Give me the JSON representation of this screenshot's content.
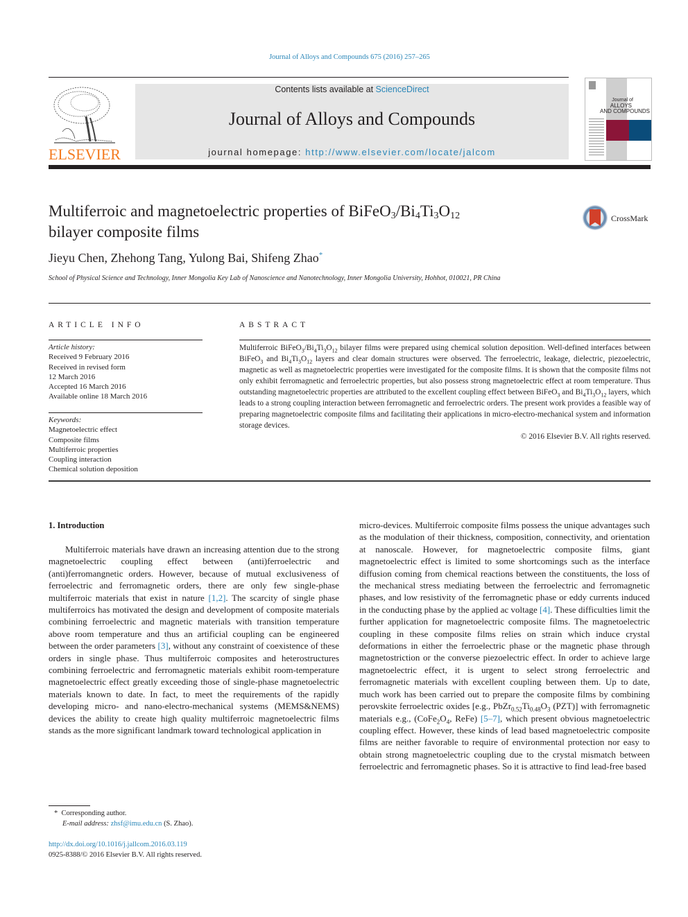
{
  "citation": "Journal of Alloys and Compounds 675 (2016) 257–265",
  "publisher": {
    "logo_text": "ELSEVIER",
    "logo_color": "#f47b20"
  },
  "header": {
    "contents_prefix": "Contents lists available at ",
    "contents_link": "ScienceDirect",
    "journal_title": "Journal of Alloys and Compounds",
    "homepage_prefix": "journal homepage: ",
    "homepage_url": "http://www.elsevier.com/locate/jalcom",
    "box_color": "#e6e6e6"
  },
  "cover": {
    "title_line1": "Journal of",
    "title_line2": "ALLOYS",
    "title_line3": "AND COMPOUNDS",
    "colors": {
      "crimson": "#8b1538",
      "blue": "#0a4c7a"
    }
  },
  "crossmark": {
    "label": "CrossMark"
  },
  "article": {
    "title_part1": "Multiferroic and magnetoelectric properties of BiFeO",
    "title_sub1": "3",
    "title_part2": "/Bi",
    "title_sub2": "4",
    "title_part3": "Ti",
    "title_sub3": "3",
    "title_part4": "O",
    "title_sub4": "12",
    "title_line2": "bilayer composite films",
    "authors": "Jieyu Chen, Zhehong Tang, Yulong Bai, Shifeng Zhao",
    "corresponding_mark": "*",
    "affiliation": "School of Physical Science and Technology, Inner Mongolia Key Lab of Nanoscience and Nanotechnology, Inner Mongolia University, Hohhot, 010021, PR China"
  },
  "article_info": {
    "heading": "ARTICLE INFO",
    "history_label": "Article history:",
    "history": [
      "Received 9 February 2016",
      "Received in revised form",
      "12 March 2016",
      "Accepted 16 March 2016",
      "Available online 18 March 2016"
    ],
    "keywords_label": "Keywords:",
    "keywords": [
      "Magnetoelectric effect",
      "Composite films",
      "Multiferroic properties",
      "Coupling interaction",
      "Chemical solution deposition"
    ]
  },
  "abstract": {
    "heading": "ABSTRACT",
    "s1a": "Multiferroic BiFeO",
    "s1b": "/Bi",
    "s1c": "Ti",
    "s1d": "O",
    "s1e": " bilayer films were prepared using chemical solution deposition. Well-defined interfaces between BiFeO",
    "s1f": " and Bi",
    "s1g": "Ti",
    "s1h": "O",
    "s1i": " layers and clear domain structures were observed. The ferroelectric, leakage, dielectric, piezoelectric, magnetic as well as magnetoelectric properties were investigated for the composite films. It is shown that the composite films not only exhibit ferromagnetic and ferroelectric properties, but also possess strong magnetoelectric effect at room temperature. Thus outstanding magnetoelectric properties are attributed to the excellent coupling effect between BiFeO",
    "s1j": " and Bi",
    "s1k": "Ti",
    "s1l": "O",
    "s1m": " layers, which leads to a strong coupling interaction between ferromagnetic and ferroelectric orders. The present work provides a feasible way of preparing magnetoelectric composite films and facilitating their applications in micro-electro-mechanical system and information storage devices.",
    "copyright": "© 2016 Elsevier B.V. All rights reserved."
  },
  "intro": {
    "heading": "1.  Introduction",
    "left": {
      "t1": "Multiferroic materials have drawn an increasing attention due to the strong magnetoelectric coupling effect between (anti)ferroelectric and (anti)ferromangnetic orders. However, because of mutual exclusiveness of ferroelectric and ferromagnetic orders, there are only few single-phase multiferroic materials that exist in nature ",
      "ref1": "[1,2]",
      "t2": ". The scarcity of single phase multiferroics has motivated the design and development of composite materials combining ferroelectric and magnetic materials with transition temperature above room temperature and thus an artificial coupling can be engineered between the order parameters ",
      "ref2": "[3]",
      "t3": ", without any constraint of coexistence of these orders in single phase. Thus multiferroic composites and heterostructures combining ferroelectric and ferromagnetic materials exhibit room-temperature magnetoelectric effect greatly exceeding those of single-phase magnetoelectric materials known to date. In fact, to meet the requirements of the rapidly developing micro- and nano-electro-mechanical systems (MEMS&NEMS) devices the ability to create high quality multiferroic magnetoelectric films stands as the more significant landmark toward technological application in"
    },
    "right": {
      "t1": "micro-devices. Multiferroic composite films possess the unique advantages such as the modulation of their thickness, composition, connectivity, and orientation at nanoscale. However, for magnetoelectric composite films, giant magnetoelectric effect is limited to some shortcomings such as the interface diffusion coming from chemical reactions between the constituents, the loss of the mechanical stress mediating between the ferroelectric and ferromagnetic phases, and low resistivity of the ferromagnetic phase or eddy currents induced in the conducting phase by the applied ac voltage ",
      "ref1": "[4]",
      "t2": ". These difficulties limit the further application for magnetoelectric composite films. The magnetoelectric coupling in these composite films relies on strain which induce crystal deformations in either the ferroelectric phase or the magnetic phase through magnetostriction or the converse piezoelectric effect. In order to achieve large magnetoelectric effect, it is urgent to select strong ferroelectric and ferromagnetic materials with excellent coupling between them. Up to date, much work has been carried out to prepare the composite films by combining perovskite ferroelectric oxides [e.g., PbZr",
      "sub1": "0.52",
      "t3": "Ti",
      "sub2": "0.48",
      "t4": "O",
      "sub3": "3",
      "t5": " (PZT)] with ferromagnetic materials e.g., (CoFe",
      "sub4": "2",
      "t6": "O",
      "sub5": "4",
      "t7": ", ReFe) ",
      "ref2": "[5–7]",
      "t8": ", which present obvious magnetoelectric coupling effect. However, these kinds of lead based magnetoelectric composite films are neither favorable to require of environmental protection nor easy to obtain strong magnetoelectric coupling due to the crystal mismatch between ferroelectric and ferromagnetic phases. So it is attractive to find lead-free based"
    }
  },
  "footnote": {
    "mark": "*",
    "corresponding": "Corresponding author.",
    "email_label": "E-mail address: ",
    "email": "zhsf@imu.edu.cn",
    "email_suffix": " (S. Zhao)."
  },
  "doi": {
    "url": "http://dx.doi.org/10.1016/j.jallcom.2016.03.119",
    "issn_line": "0925-8388/© 2016 Elsevier B.V. All rights reserved."
  },
  "colors": {
    "link": "#2a86b8",
    "text": "#231f20"
  }
}
